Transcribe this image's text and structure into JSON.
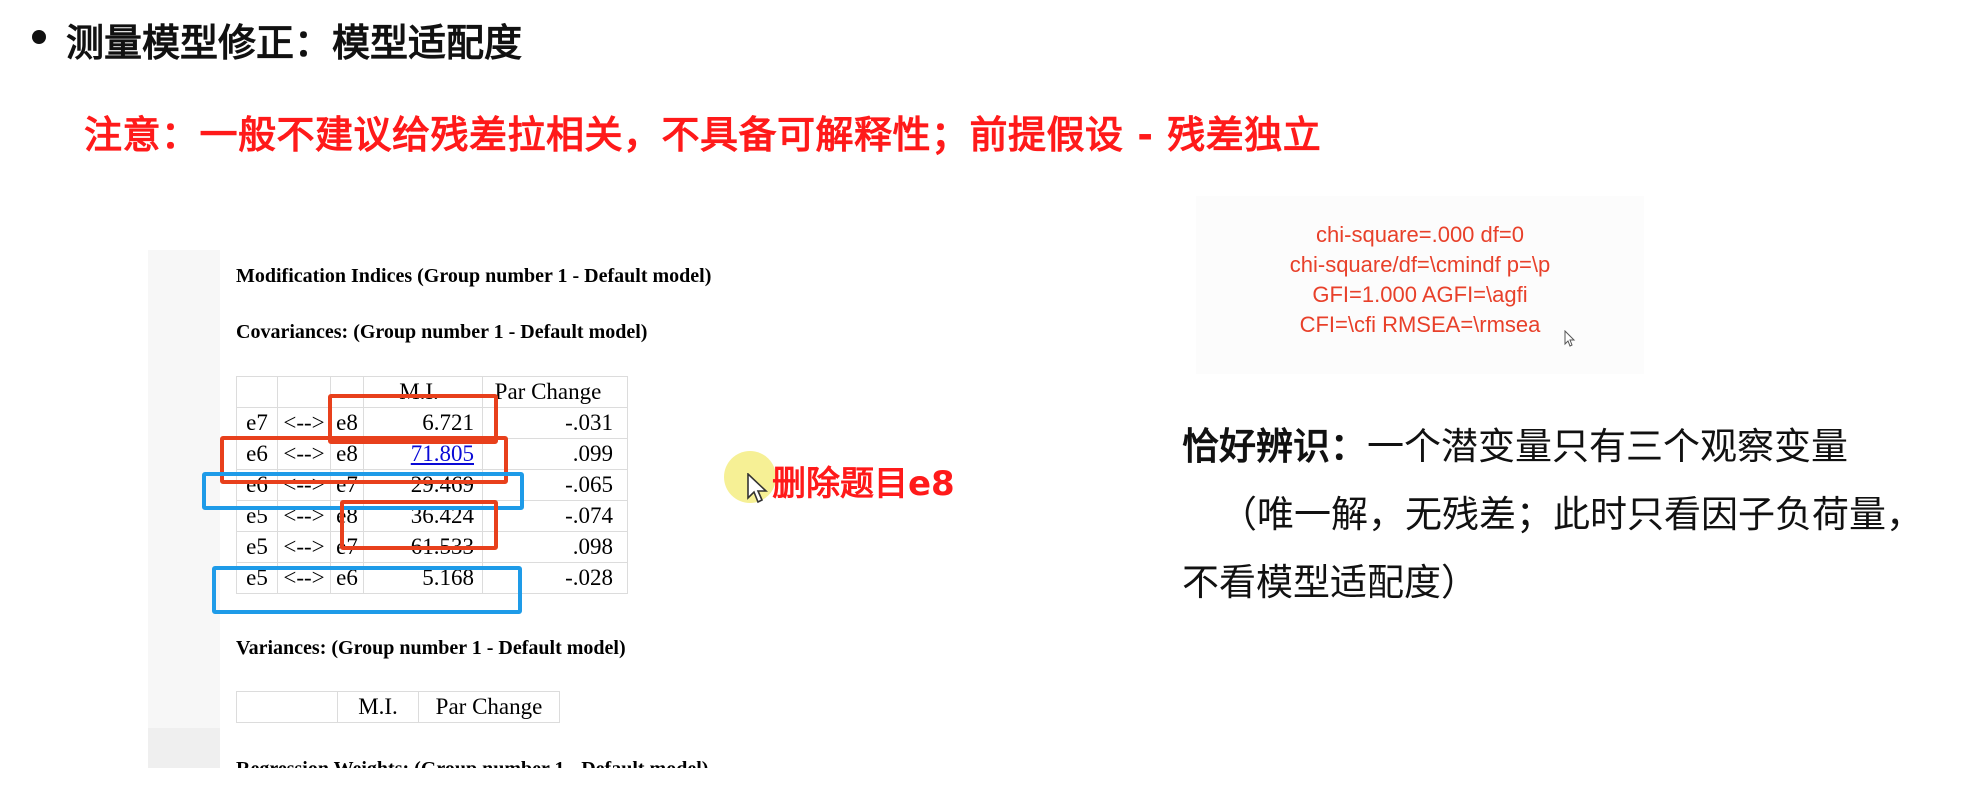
{
  "slide": {
    "title": "测量模型修正：模型适配度",
    "warning": "注意：一般不建议给残差拉相关，不具备可解释性；前提假设 - 残差独立"
  },
  "amos": {
    "mod_indices_title": "Modification Indices (Group number 1 - Default model)",
    "covariances_title": "Covariances: (Group number 1 - Default model)",
    "table_headers": {
      "mi": "M.I.",
      "par_change": "Par Change"
    },
    "rows": [
      {
        "v1": "e7",
        "arrow": "<-->",
        "v2": "e8",
        "mi": "6.721",
        "pc": "-.031"
      },
      {
        "v1": "e6",
        "arrow": "<-->",
        "v2": "e8",
        "mi": "71.805",
        "pc": ".099"
      },
      {
        "v1": "e6",
        "arrow": "<-->",
        "v2": "e7",
        "mi": "29.469",
        "pc": "-.065"
      },
      {
        "v1": "e5",
        "arrow": "<-->",
        "v2": "e8",
        "mi": "36.424",
        "pc": "-.074"
      },
      {
        "v1": "e5",
        "arrow": "<-->",
        "v2": "e7",
        "mi": "61.533",
        "pc": ".098"
      },
      {
        "v1": "e5",
        "arrow": "<-->",
        "v2": "e6",
        "mi": "5.168",
        "pc": "-.028"
      }
    ],
    "variances_title": "Variances: (Group number 1 - Default model)",
    "variances_headers": {
      "mi": "M.I.",
      "par_change": "Par Change"
    },
    "regression_title_partial": "Regression Weights: (Group number 1 - Default model)"
  },
  "annotation": {
    "delete_note": "删除题目e8"
  },
  "fit_template": {
    "line1": "chi-square=.000 df=0",
    "line2": "chi-square/df=\\cmindf p=\\p",
    "line3": "GFI=1.000 AGFI=\\agfi",
    "line4": "CFI=\\cfi RMSEA=\\rmsea"
  },
  "explanation": {
    "term": "恰好辨识：",
    "definition": "一个潜变量只有三个观察变量",
    "line2": "（唯一解，无残差；此时只看因子负荷量，",
    "line3": "不看模型适配度）"
  },
  "colors": {
    "warning": "#ff1a1a",
    "highlight_red": "#e8401c",
    "highlight_blue": "#1e9be8",
    "fit_text": "#e8402a",
    "link": "#0a0ad6"
  }
}
